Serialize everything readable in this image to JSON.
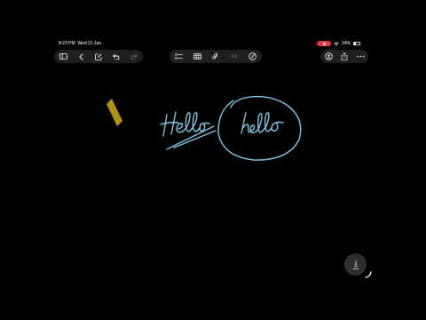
{
  "status_bar": {
    "time": "8:23 PM",
    "date": "Wed 21 Jan",
    "battery_percent": "34%",
    "battery_level": 0.34,
    "recording_color": "#e8343f"
  },
  "toolbar_left": {
    "icons": [
      "sidebar-icon",
      "chevron-left-icon",
      "compose-icon",
      "undo-icon",
      "redo-icon"
    ]
  },
  "toolbar_middle": {
    "icons": [
      "checklist-icon",
      "table-icon",
      "attachment-icon",
      "text-format-icon",
      "markup-pen-icon"
    ],
    "format_label": "Aa"
  },
  "toolbar_right": {
    "icons": [
      "collaborate-icon",
      "share-icon",
      "more-icon"
    ]
  },
  "canvas": {
    "ink_color": "#7cc6e3",
    "highlighter_color": "#c7a214",
    "handwritten_words": [
      "Hello",
      "hello"
    ]
  },
  "colors": {
    "background": "#000000",
    "toolbar_bg": "#1f1f21",
    "icon": "#ffffff"
  }
}
